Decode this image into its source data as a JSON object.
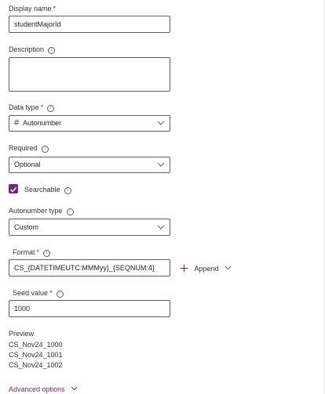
{
  "fields": {
    "display_name": {
      "label": "Display name",
      "required_mark": "*",
      "value": "studentMajorId"
    },
    "description": {
      "label": "Description",
      "info_icon": "info-icon",
      "value": ""
    },
    "data_type": {
      "label": "Data type",
      "required_mark": "*",
      "info_icon": "info-icon",
      "type_icon": "#",
      "selected": "Autonumber"
    },
    "required": {
      "label": "Required",
      "info_icon": "info-icon",
      "selected": "Optional"
    },
    "searchable": {
      "label": "Searchable",
      "checked": true,
      "info_icon": "info-icon"
    },
    "autonumber_type": {
      "label": "Autonumber type",
      "info_icon": "info-icon",
      "selected": "Custom"
    },
    "format": {
      "label": "Format",
      "required_mark": "*",
      "info_icon": "info-icon",
      "value": "CS_{DATETIMEUTC:MMMyy}_{SEQNUM:4}",
      "append_label": "Append"
    },
    "seed_value": {
      "label": "Seed value",
      "required_mark": "*",
      "info_icon": "info-icon",
      "value": "1000"
    }
  },
  "preview": {
    "label": "Preview",
    "lines": [
      "CS_Nov24_1000",
      "CS_Nov24_1001",
      "CS_Nov24_1002"
    ]
  },
  "advanced_options": {
    "label": "Advanced options"
  },
  "colors": {
    "accent": "#742774",
    "required": "#a4262c",
    "border": "#605e5c",
    "text": "#323130"
  }
}
